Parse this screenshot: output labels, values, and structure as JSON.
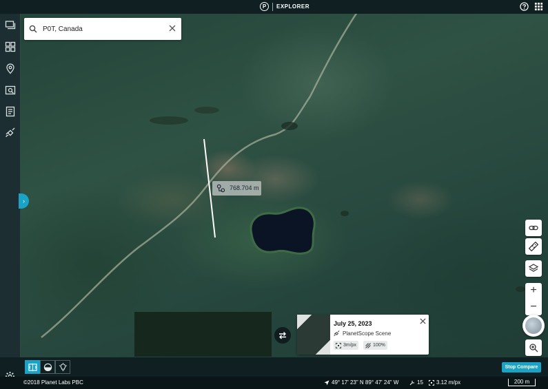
{
  "app": {
    "brand_logo_letter": "P",
    "brand_name": "EXPLORER"
  },
  "search": {
    "value": "P0T, Canada"
  },
  "measure": {
    "distance": "768.704 m"
  },
  "scene": {
    "date": "July 25, 2023",
    "type": "PlanetScope Scene",
    "resolution": "3m/px",
    "coverage": "100%"
  },
  "toolbar": {
    "stop_compare_label": "Stop Compare"
  },
  "status": {
    "copyright": "©2018 Planet Labs PBC",
    "coordinates": "49° 17' 23\" N 89° 47' 24\" W",
    "zoom_level": "15",
    "resolution": "3.12 m/px",
    "scale": "200 m"
  },
  "colors": {
    "accent": "#1aa3c4",
    "chrome": "#0f1f22",
    "rail": "#1c2e31"
  }
}
